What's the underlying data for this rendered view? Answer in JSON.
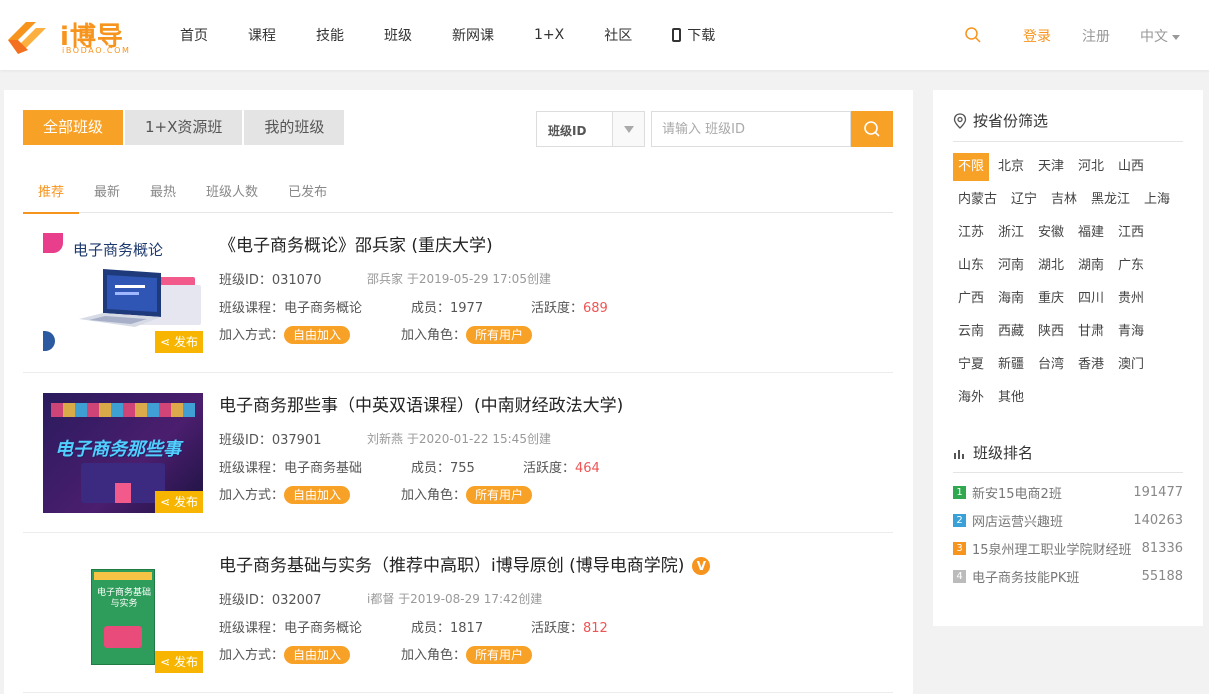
{
  "header": {
    "logo": {
      "name": "i博导",
      "sub": "iBODAO.COM"
    },
    "nav": [
      "首页",
      "课程",
      "技能",
      "班级",
      "新网课",
      "1+X",
      "社区",
      "下载"
    ],
    "login": "登录",
    "register": "注册",
    "language": "中文"
  },
  "tabs": [
    "全部班级",
    "1+X资源班",
    "我的班级"
  ],
  "filter": {
    "select_value": "班级ID",
    "placeholder": "请输入 班级ID"
  },
  "subtabs": [
    "推荐",
    "最新",
    "最热",
    "班级人数",
    "已发布"
  ],
  "courses": [
    {
      "title": "《电子商务概论》邵兵家 (重庆大学)",
      "thumb_text": "电子商务概论",
      "id_label": "班级ID：",
      "id": "031070",
      "creator": "邵兵家 于2019-05-29 17:05创建",
      "course_label": "班级课程：",
      "course": "电子商务概论",
      "members_label": "成员：",
      "members": "1977",
      "activity_label": "活跃度：",
      "activity": "689",
      "join_label": "加入方式：",
      "join": "自由加入",
      "role_label": "加入角色：",
      "role": "所有用户",
      "share": "发布",
      "verified": false
    },
    {
      "title": "电子商务那些事（中英双语课程）(中南财经政法大学)",
      "thumb_text": "电子商务那些事",
      "id_label": "班级ID：",
      "id": "037901",
      "creator": "刘新燕 于2020-01-22 15:45创建",
      "course_label": "班级课程：",
      "course": "电子商务基础",
      "members_label": "成员：",
      "members": "755",
      "activity_label": "活跃度：",
      "activity": "464",
      "join_label": "加入方式：",
      "join": "自由加入",
      "role_label": "加入角色：",
      "role": "所有用户",
      "share": "发布",
      "verified": false
    },
    {
      "title": "电子商务基础与实务（推荐中高职）i博导原创 (博导电商学院)",
      "thumb_text": "电子商务基础与实务",
      "id_label": "班级ID：",
      "id": "032007",
      "creator": "i都督 于2019-08-29 17:42创建",
      "course_label": "班级课程：",
      "course": "电子商务概论",
      "members_label": "成员：",
      "members": "1817",
      "activity_label": "活跃度：",
      "activity": "812",
      "join_label": "加入方式：",
      "join": "自由加入",
      "role_label": "加入角色：",
      "role": "所有用户",
      "share": "发布",
      "verified": true,
      "verified_mark": "V"
    }
  ],
  "sidebar": {
    "province_title": "按省份筛选",
    "provinces": [
      [
        "不限",
        "北京",
        "天津",
        "河北",
        "山西"
      ],
      [
        "内蒙古",
        "辽宁",
        "吉林",
        "黑龙江",
        "上海"
      ],
      [
        "江苏",
        "浙江",
        "安徽",
        "福建",
        "江西"
      ],
      [
        "山东",
        "河南",
        "湖北",
        "湖南",
        "广东"
      ],
      [
        "广西",
        "海南",
        "重庆",
        "四川",
        "贵州"
      ],
      [
        "云南",
        "西藏",
        "陕西",
        "甘肃",
        "青海"
      ],
      [
        "宁夏",
        "新疆",
        "台湾",
        "香港",
        "澳门"
      ],
      [
        "海外",
        "其他"
      ]
    ],
    "ranking_title": "班级排名",
    "ranking": [
      {
        "rank": "1",
        "name": "新安15电商2班",
        "value": "191477",
        "color": "#2fa84f"
      },
      {
        "rank": "2",
        "name": "网店运营兴趣班",
        "value": "140263",
        "color": "#3aa0d8"
      },
      {
        "rank": "3",
        "name": "15泉州理工职业学院财经班",
        "value": "81336",
        "color": "#f7941d"
      },
      {
        "rank": "4",
        "name": "电子商务技能PK班",
        "value": "55188",
        "color": "#bbbbbb"
      }
    ]
  },
  "colors": {
    "accent": "#f7a126",
    "brand": "#f7941d",
    "hot": "#e55555"
  }
}
